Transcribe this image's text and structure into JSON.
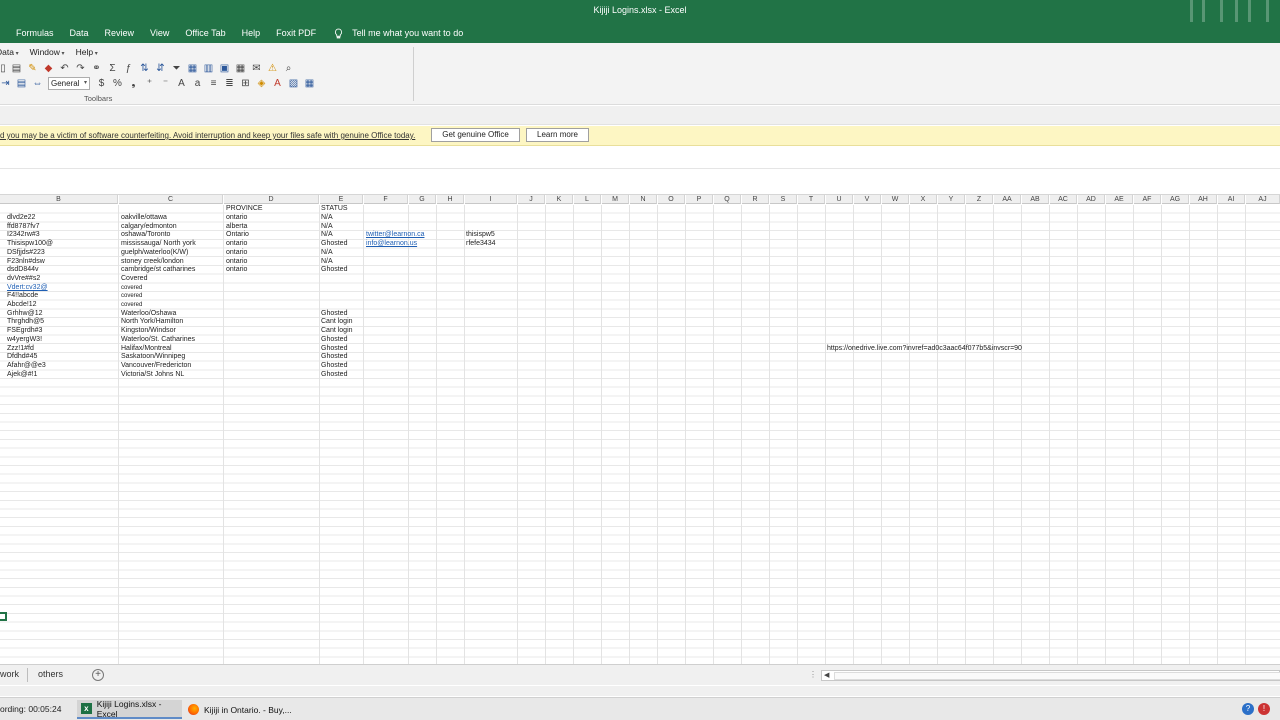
{
  "window": {
    "title": "Kijiji Logins.xlsx  -  Excel"
  },
  "menu": {
    "items": [
      "Formulas",
      "Data",
      "Review",
      "View",
      "Office Tab",
      "Help",
      "Foxit PDF"
    ],
    "tell_me": "Tell me what you want to do"
  },
  "toolbar_menu": {
    "items": [
      "Data",
      "Window",
      "Help"
    ]
  },
  "toolbar": {
    "number_format": "General",
    "group_label": "Toolbars"
  },
  "message_bar": {
    "text": "d you may be a victim of software counterfeiting. Avoid interruption and keep your files safe with genuine Office today.",
    "primary_button": "Get genuine Office",
    "secondary_button": "Learn more"
  },
  "sheet": {
    "columns": [
      "B",
      "C",
      "D",
      "E",
      "F",
      "G",
      "H",
      "I",
      "J",
      "K",
      "L",
      "M",
      "N",
      "O",
      "P",
      "Q",
      "R",
      "S",
      "T",
      "U",
      "V",
      "W",
      "X",
      "Y",
      "Z",
      "AA",
      "AB",
      "AC",
      "AD",
      "AE",
      "AF",
      "AG",
      "AH",
      "AI",
      "AJ"
    ],
    "headers": {
      "province": "PROVINCE",
      "status": "STATUS"
    },
    "rows": [
      {
        "b": "dlvd2e22",
        "c": "oakville/ottawa",
        "d": "ontario",
        "e": "N/A"
      },
      {
        "b": "ffd8787fv7",
        "c": "calgary/edmonton",
        "d": "alberta",
        "e": "N/A"
      },
      {
        "b": "I2342rw#3",
        "c": "oshawa/Toronto",
        "d": "Ontario",
        "e": "N/A",
        "f": "twitter@learnon.ca",
        "i": "thisispw5"
      },
      {
        "b": "Thisispw100@",
        "c": "mississauga/ North york",
        "d": "ontario",
        "e": "Ghosted",
        "f": "info@learnon.us",
        "i": "rfefe3434"
      },
      {
        "b": "DSfjjds#223",
        "c": "guelph/waterloo(K/W)",
        "d": "ontario",
        "e": "N/A"
      },
      {
        "b": "F23nln#dsw",
        "c": "stoney creek/london",
        "d": "ontario",
        "e": "N/A"
      },
      {
        "b": "dsdD844v",
        "c": "cambridge/st catharines",
        "d": "ontario",
        "e": "Ghosted"
      },
      {
        "b": "dvVre##s2",
        "c": "Covered"
      },
      {
        "b": "Vdert:cv32@",
        "c": "covered",
        "link": true
      },
      {
        "b": "F4!!abcde",
        "c": "covered"
      },
      {
        "b": "Abcde!12",
        "c": "covered"
      },
      {
        "b": "Grhhw@12",
        "c": "Waterloo/Oshawa",
        "e": "Ghosted"
      },
      {
        "b": "Thrghdh@5",
        "c": "North York/Hamilton",
        "e": "Cant login"
      },
      {
        "b": "FSEgrdh#3",
        "c": "Kingston/Windsor",
        "e": "Cant login"
      },
      {
        "b": "w4yergW3!",
        "c": "Waterloo/St. Catharines",
        "e": "Ghosted"
      },
      {
        "b": "Zzz!1#fd",
        "c": "Halifax/Montreal",
        "e": "Ghosted",
        "u": "https://onedrive.live.com?invref=ad0c3aac64f077b5&invscr=90"
      },
      {
        "b": "Dfdhd#45",
        "c": "Saskatoon/Winnipeg",
        "e": "Ghosted"
      },
      {
        "b": "Afahr@@e3",
        "c": "Vancouver/Fredericton",
        "e": "Ghosted"
      },
      {
        "b": "Ajek@#!1",
        "c": "Victoria/St Johns NL",
        "e": "Ghosted"
      }
    ]
  },
  "sheet_tabs": [
    "work",
    "others"
  ],
  "taskbar": {
    "recording": "ording:  00:05:24",
    "tasks": [
      "Kijiji Logins.xlsx - Excel",
      "Kijiji in Ontario. - Buy,..."
    ]
  }
}
